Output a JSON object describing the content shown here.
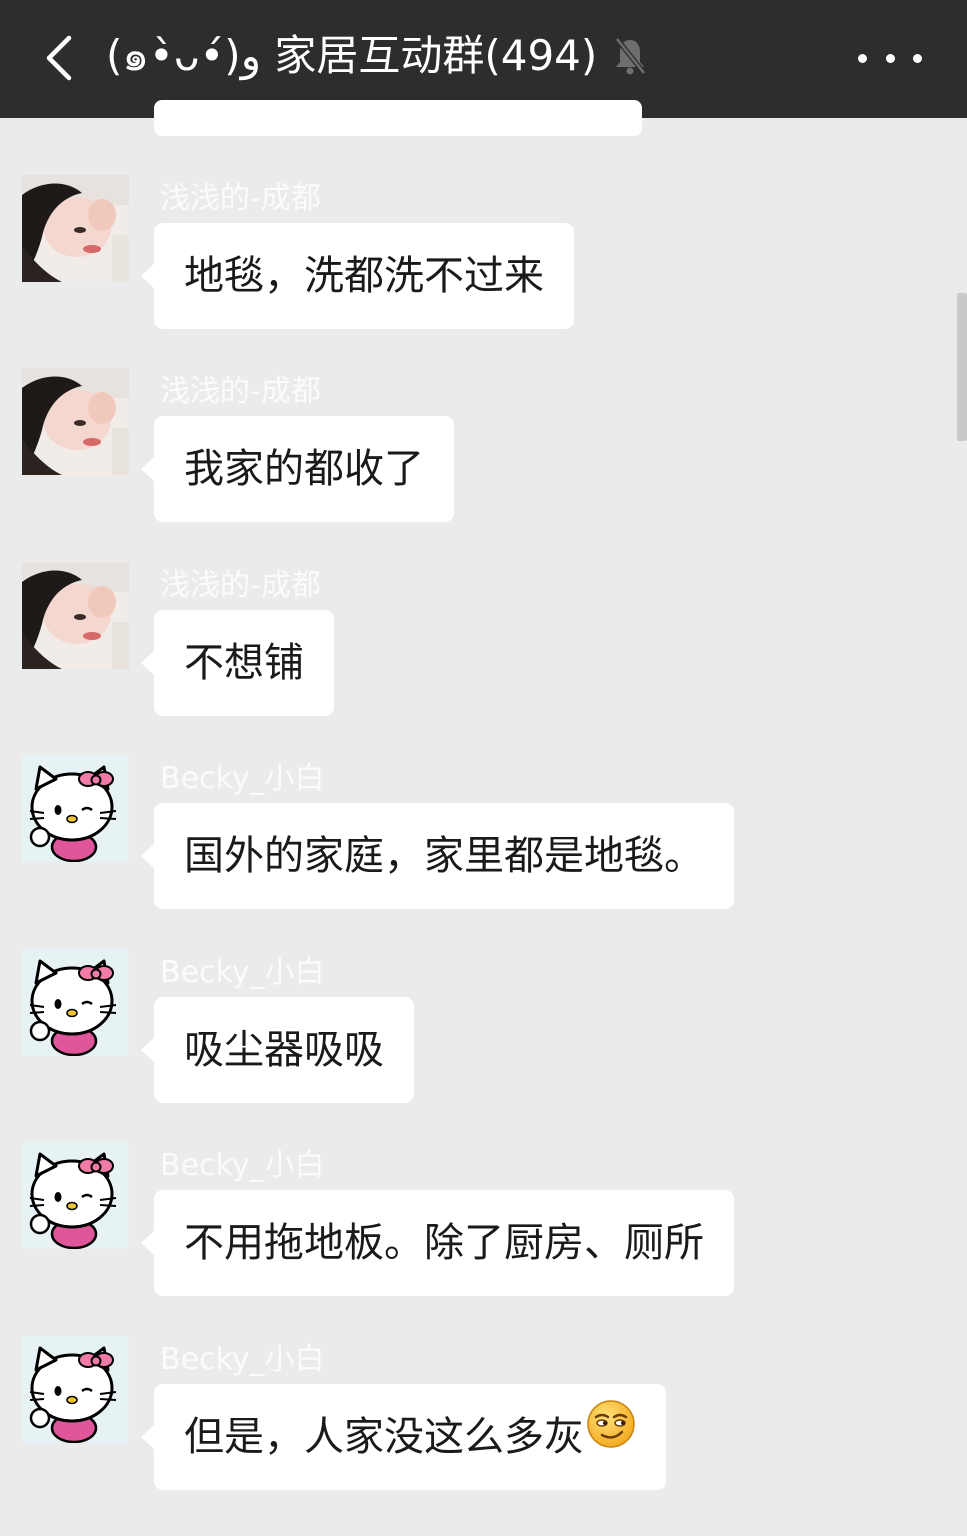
{
  "header": {
    "title": "(๑•̀ᴗ•́)و 家居互动群(494)",
    "back_icon": "chevron-left-icon",
    "mute_icon": "bell-muted-icon",
    "more_icon": "more-dots-icon"
  },
  "messages": [
    {
      "sender": "浅浅的-成都",
      "text": "地毯，洗都洗不过来",
      "avatar": "woman-photo"
    },
    {
      "sender": "浅浅的-成都",
      "text": "我家的都收了",
      "avatar": "woman-photo"
    },
    {
      "sender": "浅浅的-成都",
      "text": "不想铺",
      "avatar": "woman-photo"
    },
    {
      "sender": "Becky_小白",
      "text": "国外的家庭，家里都是地毯。",
      "avatar": "hello-kitty"
    },
    {
      "sender": "Becky_小白",
      "text": "吸尘器吸吸",
      "avatar": "hello-kitty"
    },
    {
      "sender": "Becky_小白",
      "text": "不用拖地板。除了厨房、厕所",
      "avatar": "hello-kitty"
    },
    {
      "sender": "Becky_小白",
      "text": "但是，人家没这么多灰",
      "avatar": "hello-kitty",
      "emoji": "smirk-emoji"
    }
  ]
}
